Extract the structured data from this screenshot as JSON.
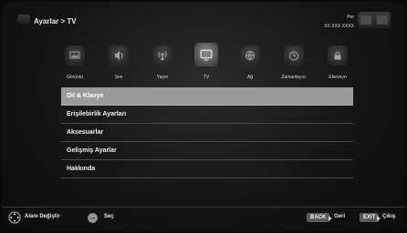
{
  "header": {
    "breadcrumb": "Ayarlar > TV",
    "day": "Per",
    "date": "XX XXX XXXX"
  },
  "categories": [
    {
      "label": "Görüntü",
      "icon": "picture-icon"
    },
    {
      "label": "Ses",
      "icon": "sound-icon"
    },
    {
      "label": "Yayın",
      "icon": "broadcast-icon"
    },
    {
      "label": "TV",
      "icon": "tv-icon",
      "active": true
    },
    {
      "label": "Ağ",
      "icon": "network-icon"
    },
    {
      "label": "Zamanlayıcı",
      "icon": "timer-icon"
    },
    {
      "label": "Ebeveyn",
      "icon": "parental-lock-icon"
    }
  ],
  "menu": {
    "items": [
      {
        "label": "Dil & Klavye",
        "selected": true
      },
      {
        "label": "Erişilebirlik Ayarları"
      },
      {
        "label": "Aksesuarlar"
      },
      {
        "label": "Gelişmiş Ayarlar"
      },
      {
        "label": "Hakkında"
      }
    ]
  },
  "footer": {
    "change_area": "Alanı Değiştir",
    "ok_icon_text": "OK",
    "select": "Seç",
    "back_key": "BACK",
    "back_label": "Geri",
    "exit_key": "EXIT",
    "exit_label": "Çıkış"
  },
  "colors": {
    "selected_row": "#9b9b9b",
    "background": "#151515",
    "text": "#ffffff"
  }
}
